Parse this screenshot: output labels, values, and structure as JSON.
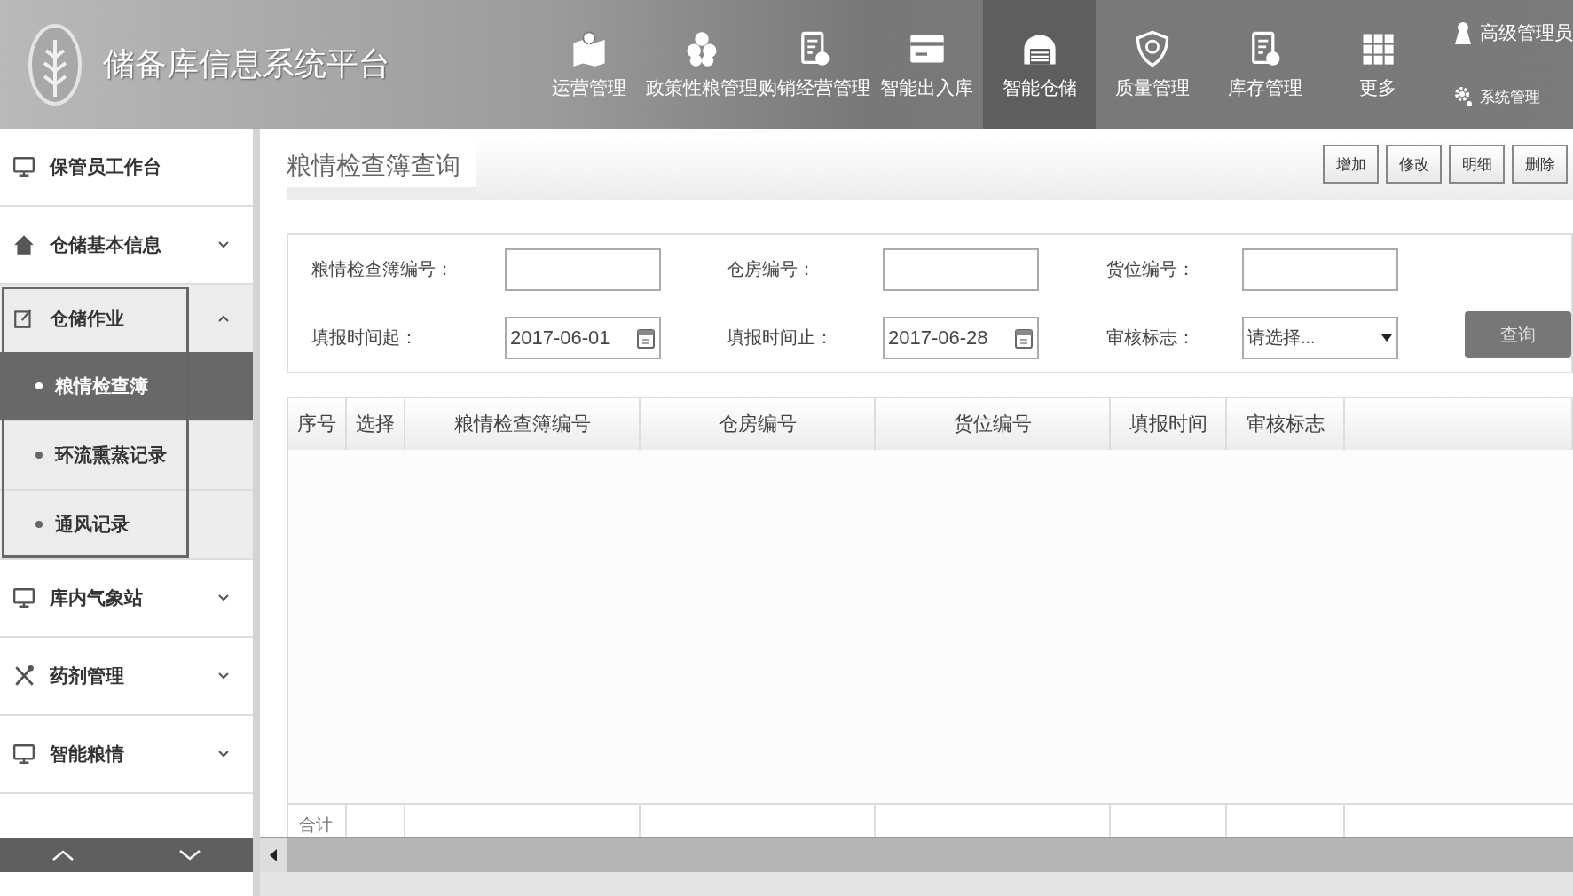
{
  "app": {
    "title": "储备库信息系统平台"
  },
  "nav": [
    {
      "label": "运营管理",
      "selected": false
    },
    {
      "label": "政策性粮管理",
      "selected": false
    },
    {
      "label": "购销经营管理",
      "selected": false
    },
    {
      "label": "智能出入库",
      "selected": false
    },
    {
      "label": "智能仓储",
      "selected": true
    },
    {
      "label": "质量管理",
      "selected": false
    },
    {
      "label": "库存管理",
      "selected": false
    },
    {
      "label": "更多",
      "selected": false
    }
  ],
  "user": {
    "name": "高级管理员",
    "settings": "系统管理"
  },
  "sidebar": [
    {
      "label": "保管员工作台"
    },
    {
      "label": "仓储基本信息",
      "expanded": false
    },
    {
      "label": "仓储作业",
      "expanded": true,
      "children": [
        {
          "label": "粮情检查簿",
          "selected": true
        },
        {
          "label": "环流熏蒸记录",
          "selected": false
        },
        {
          "label": "通风记录",
          "selected": false
        }
      ]
    },
    {
      "label": "库内气象站",
      "expanded": false
    },
    {
      "label": "药剂管理",
      "expanded": false
    },
    {
      "label": "智能粮情",
      "expanded": false
    }
  ],
  "page": {
    "title": "粮情检查簿查询",
    "actions": [
      "增加",
      "修改",
      "明细",
      "删除"
    ],
    "filters": [
      {
        "label": "粮情检查簿编号：",
        "kind": "text"
      },
      {
        "label": "仓房编号：",
        "kind": "text"
      },
      {
        "label": "货位编号：",
        "kind": "text"
      },
      {
        "label": "填报时间起：",
        "kind": "date",
        "value": "2017-06-01"
      },
      {
        "label": "填报时间止：",
        "kind": "date",
        "value": "2017-06-28"
      },
      {
        "label": "审核标志：",
        "kind": "select",
        "value": "请选择..."
      }
    ],
    "query_button": "查询",
    "table": {
      "columns": [
        "序号",
        "选择",
        "粮情检查簿编号",
        "仓房编号",
        "货位编号",
        "填报时间",
        "审核标志"
      ],
      "footer_label": "合计"
    }
  }
}
